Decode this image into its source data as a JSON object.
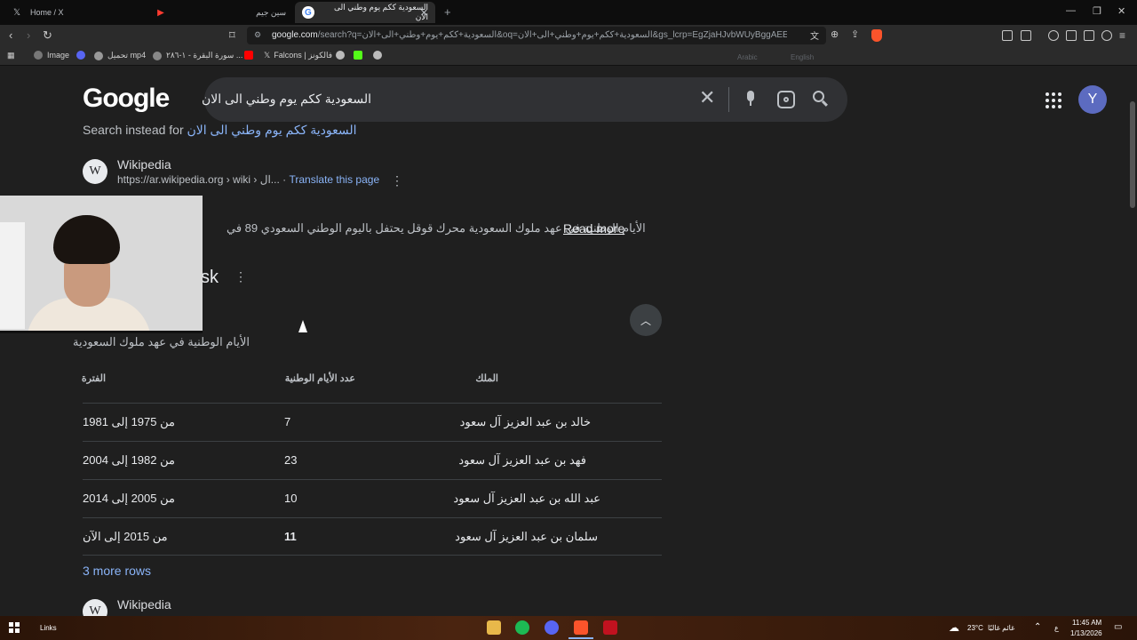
{
  "browser": {
    "tabs": [
      {
        "title": "Home / X",
        "icon": "x-logo-icon"
      },
      {
        "title": "سين جيم",
        "icon": "youtube-icon"
      },
      {
        "title": "السعودية ككم يوم وطني الى الان",
        "icon": "google-icon",
        "active": true
      }
    ],
    "window_controls": {
      "minimize": "—",
      "maximize": "❐",
      "close": "✕"
    },
    "url": "google.com",
    "url_rest": "/search?q=السعودية+ككم+يوم+وطني+الى+الان&oq=السعودية+ككم+يوم+وطني+الى+الان&gs_lcrp=EgZjaHJvbWUyBggAEEUYOTIGC...",
    "bookmarks": [
      {
        "label": "Image"
      },
      {
        "label": "تحميل mp4"
      },
      {
        "label": "سورة البقرة - ١-٢٨٦ ..."
      },
      {
        "label": ""
      },
      {
        "label": "Falcons | فالكونز"
      },
      {
        "label": ""
      },
      {
        "label": ""
      },
      {
        "label": ""
      }
    ],
    "translate_popup": {
      "from": "Arabic",
      "to": "English"
    }
  },
  "google": {
    "logo": "Google",
    "query": "السعودية ككم يوم وطني الى الان",
    "account_initial": "Y",
    "search_instead": {
      "prefix": "Search instead for",
      "link": "السعودية ككم يوم وطني الى الان"
    }
  },
  "result1": {
    "site": "Wikipedia",
    "url": "https://ar.wikipedia.org › wiki › ال...",
    "translate": "Translate this page",
    "snippet": "الأيام الوطنية في عهد ملوك السعودية محرك قوقل يحتفل باليوم الوطني السعودي 89 في",
    "read_more": "Read more"
  },
  "ask": {
    "title": "sk"
  },
  "table": {
    "caption": "الأيام الوطنية في عهد ملوك السعودية",
    "headers": {
      "king": "الملك",
      "count": "عدد الأيام الوطنية",
      "period": "الفترة"
    },
    "rows": [
      {
        "king": "خالد بن عبد العزيز آل سعود",
        "count": "7",
        "period": "من 1975 إلى 1981"
      },
      {
        "king": "فهد بن عبد العزيز آل سعود",
        "count": "23",
        "period": "من 1982 إلى 2004"
      },
      {
        "king": "عبد الله بن عبد العزيز آل سعود",
        "count": "10",
        "period": "من 2005 إلى 2014"
      },
      {
        "king": "سلمان بن عبد العزيز آل سعود",
        "count": "11",
        "period": "من 2015 إلى الآن"
      }
    ],
    "more_rows": "3 more rows"
  },
  "result2": {
    "site": "Wikipedia"
  },
  "taskbar": {
    "links": "Links",
    "weather": "23°C",
    "weather_text": "غائم غالبًا",
    "lang": "ع",
    "time": "11:45 AM",
    "date": "1/13/2026"
  }
}
